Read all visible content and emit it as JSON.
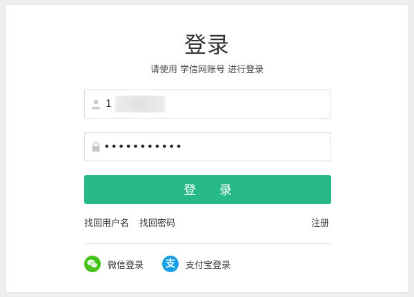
{
  "login": {
    "title": "登录",
    "subtitle": "请使用 学信网账号 进行登录",
    "username_prefix": "1",
    "password_masked": "•••••••••••",
    "login_button": "登 录",
    "find_username": "找回用户名",
    "find_password": "找回密码",
    "register": "注册"
  },
  "social": {
    "wechat_label": "微信登录",
    "alipay_label": "支付宝登录",
    "alipay_glyph": "支"
  },
  "colors": {
    "accent": "#27b98a",
    "wechat": "#44c41b",
    "alipay": "#1aa0e6"
  },
  "icons": {
    "username": "user-icon",
    "password": "lock-icon",
    "wechat": "wechat-icon",
    "alipay": "alipay-icon"
  }
}
